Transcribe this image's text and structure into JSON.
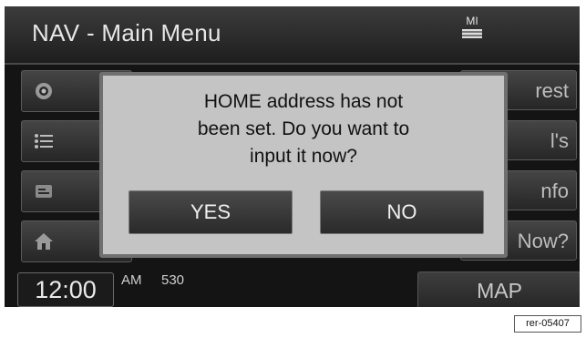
{
  "header": {
    "title": "NAV - Main Menu",
    "state_abbrev": "MI"
  },
  "left_menu": [
    {
      "icon": "gps-target-icon"
    },
    {
      "icon": "list-icon"
    },
    {
      "icon": "info-card-icon"
    },
    {
      "icon": "home-icon"
    }
  ],
  "right_menu": [
    {
      "label": "rest"
    },
    {
      "label": "l's"
    },
    {
      "label": "nfo"
    },
    {
      "label": "Now?"
    }
  ],
  "dialog": {
    "line1": "HOME address has not",
    "line2": "been set. Do you want to",
    "line3": "input it now?",
    "yes_label": "YES",
    "no_label": "NO"
  },
  "footer": {
    "time": "12:00",
    "ampm": "AM",
    "channel": "530",
    "map_label": "MAP"
  },
  "figure_tag": "rer-05407"
}
